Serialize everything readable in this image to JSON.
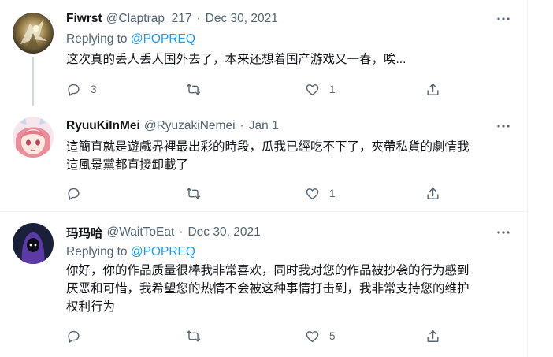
{
  "tweets": [
    {
      "name": "Fiwrst",
      "handle": "@Claptrap_217",
      "separator": "·",
      "date": "Dec 30, 2021",
      "replying_prefix": "Replying to ",
      "replying_to": "@POPREQ",
      "text_lines": [
        "这次真的丢人丢人国外去了，本来还想着国产游戏又一春，唉..."
      ],
      "reply_count": "3",
      "retweet_count": "",
      "like_count": "1",
      "avatar_icon": "avatar-anime-mech"
    },
    {
      "name": "RyuuKiInMei",
      "handle": "@RyuzakiNemei",
      "separator": "·",
      "date": "Jan 1",
      "text_lines": [
        "這簡直就是遊戲界裡最出彩的時段，瓜我已經吃不下了，夾帶私貨的劇情我",
        "這風景黨都直接卸載了"
      ],
      "reply_count": "",
      "retweet_count": "",
      "like_count": "1",
      "avatar_icon": "avatar-anime-girl"
    },
    {
      "name": "玛玛哈",
      "handle": "@WaitToEat",
      "separator": "·",
      "date": "Dec 30, 2021",
      "replying_prefix": "Replying to ",
      "replying_to": "@POPREQ",
      "text_lines": [
        "你好，你的作品质量很棒我非常喜欢，同时我对您的作品被抄袭的行为感到",
        "厌恶和可惜，我希望您的热情不会被这种事情打击到，我非常支持您的维护",
        "权利行为"
      ],
      "reply_count": "",
      "retweet_count": "",
      "like_count": "5",
      "avatar_icon": "avatar-hooded-figure"
    }
  ],
  "colors": {
    "text": "#0f1419",
    "secondary": "#536471",
    "link": "#1d9bf0",
    "border": "#eff3f4",
    "thread_line": "#cfd9de"
  }
}
